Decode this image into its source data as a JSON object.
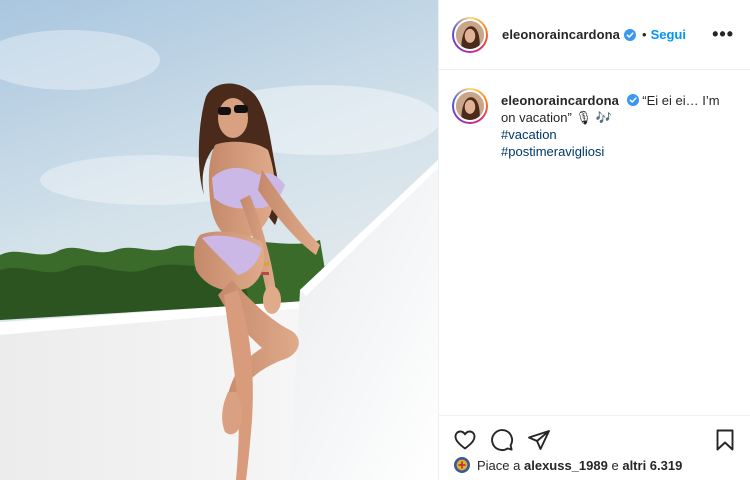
{
  "post": {
    "photo": {
      "alt_icon": "post-photo",
      "colors": {
        "sky_top": "#b8cfe0",
        "sky_bottom": "#e9eef0",
        "wall": "#f2f3f4",
        "trees": "#2f5a23",
        "bikini": "#cbb8e6"
      }
    },
    "header": {
      "username": "eleonoraincardona",
      "verified_icon": "verified-badge-icon",
      "separator": "•",
      "follow_label": "Segui",
      "more_label": "•••"
    },
    "caption": {
      "username": "eleonoraincardona",
      "text": "“Ei ei ei… I’m on vacation” 🎙 🎶",
      "hashtags": [
        "#vacation",
        "#postimeravigliosi"
      ]
    },
    "actions": {
      "like_icon": "heart-icon",
      "comment_icon": "comment-icon",
      "share_icon": "share-icon",
      "save_icon": "bookmark-icon"
    },
    "likes": {
      "prefix": "Piace a",
      "user": "alexuss_1989",
      "connector": "e",
      "others": "altri 6.319"
    },
    "accent": "#0095f6"
  }
}
